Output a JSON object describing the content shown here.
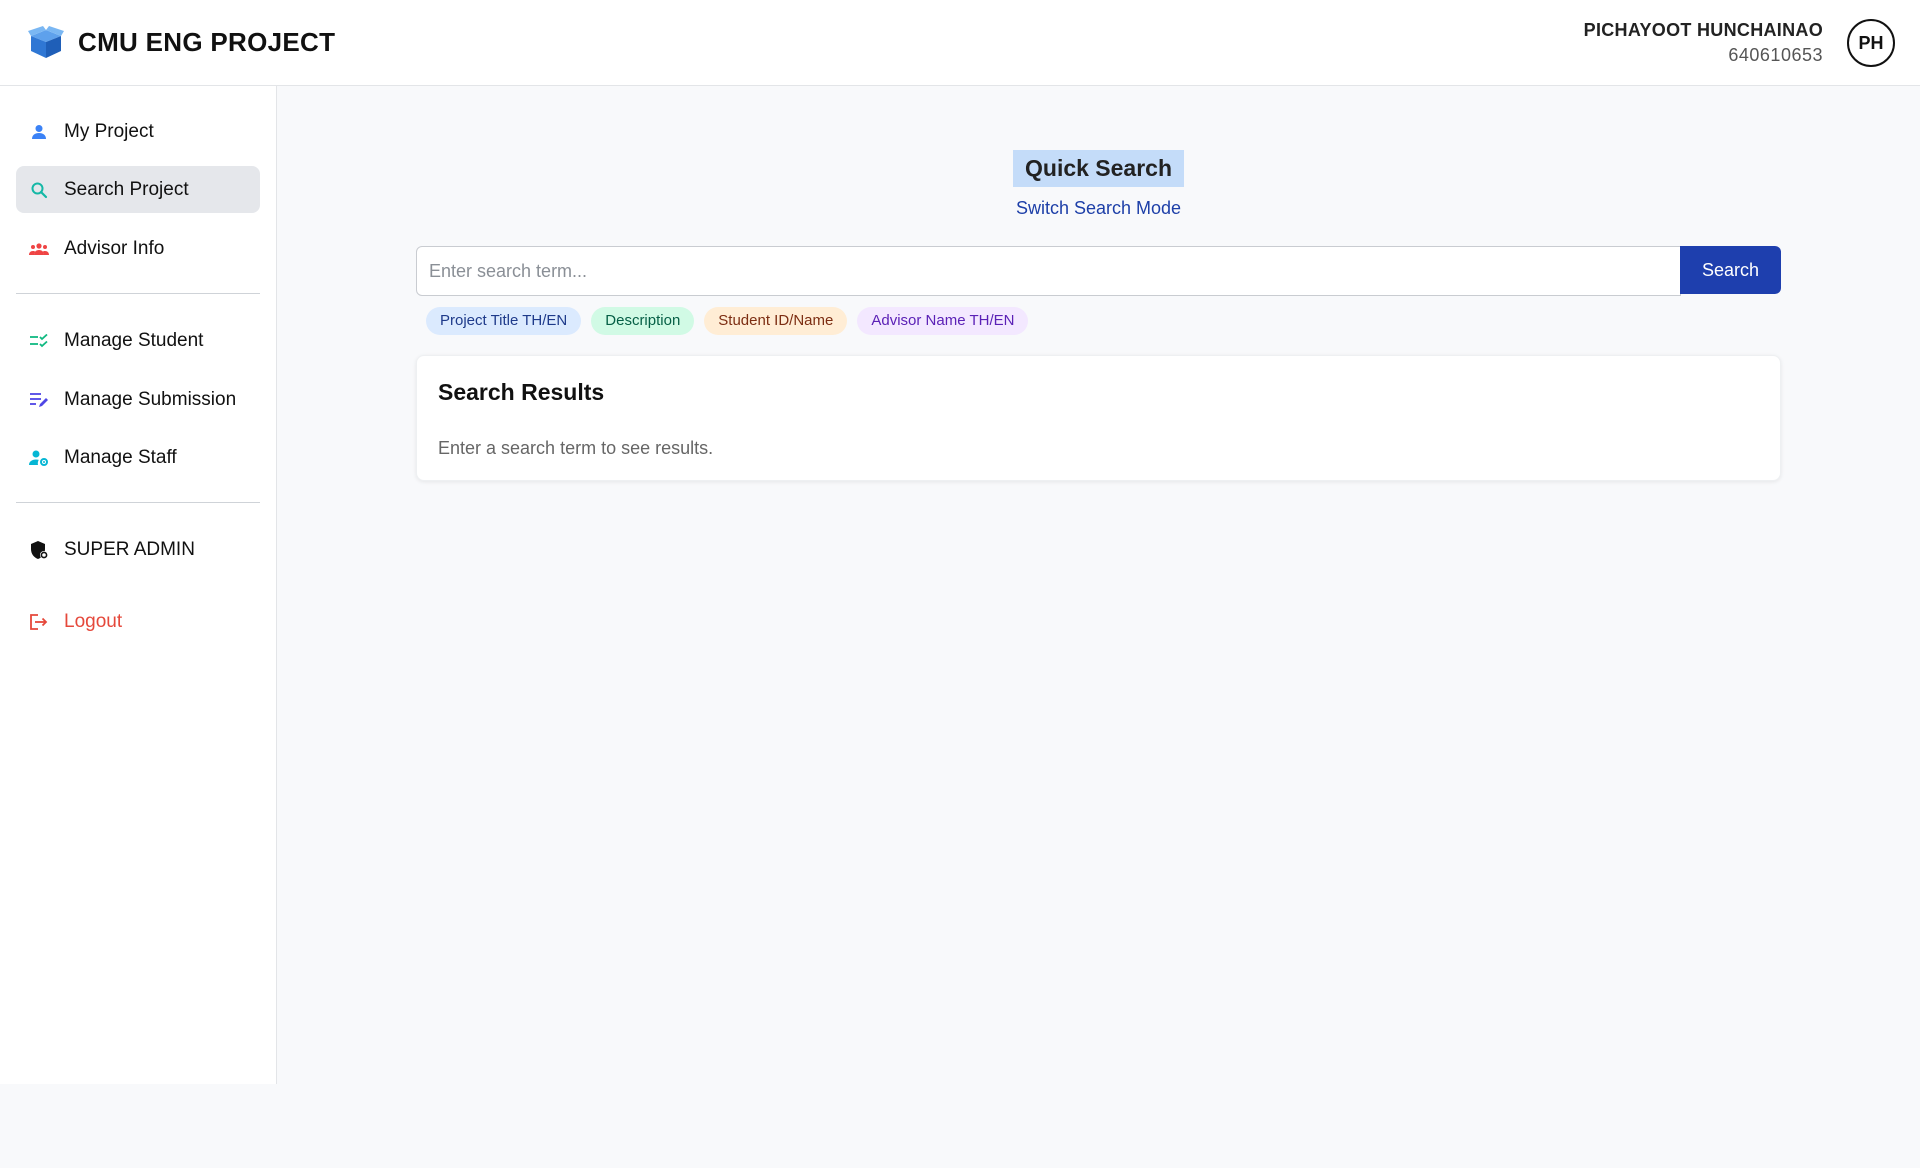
{
  "app": {
    "title": "CMU ENG PROJECT",
    "accent_color": "#1e3fae"
  },
  "user": {
    "name": "PICHAYOOT HUNCHAINAO",
    "id": "640610653",
    "initials": "PH"
  },
  "sidebar": {
    "items": [
      {
        "label": "My Project",
        "icon": "person-icon",
        "active": false
      },
      {
        "label": "Search Project",
        "icon": "search-icon",
        "active": true
      },
      {
        "label": "Advisor Info",
        "icon": "group-icon",
        "active": false
      },
      {
        "label": "Manage Student",
        "icon": "checklist-icon",
        "active": false
      },
      {
        "label": "Manage Submission",
        "icon": "edit-list-icon",
        "active": false
      },
      {
        "label": "Manage Staff",
        "icon": "person-gear-icon",
        "active": false
      },
      {
        "label": "SUPER ADMIN",
        "icon": "shield-icon",
        "active": false
      },
      {
        "label": "Logout",
        "icon": "logout-icon",
        "active": false
      }
    ]
  },
  "search": {
    "mode_title": "Quick Search",
    "switch_label": "Switch Search Mode",
    "placeholder": "Enter search term...",
    "value": "",
    "button_label": "Search",
    "chips": [
      {
        "label": "Project Title TH/EN",
        "color": "blue"
      },
      {
        "label": "Description",
        "color": "green"
      },
      {
        "label": "Student ID/Name",
        "color": "orange"
      },
      {
        "label": "Advisor Name TH/EN",
        "color": "purple"
      }
    ]
  },
  "results": {
    "title": "Search Results",
    "empty_text": "Enter a search term to see results."
  }
}
